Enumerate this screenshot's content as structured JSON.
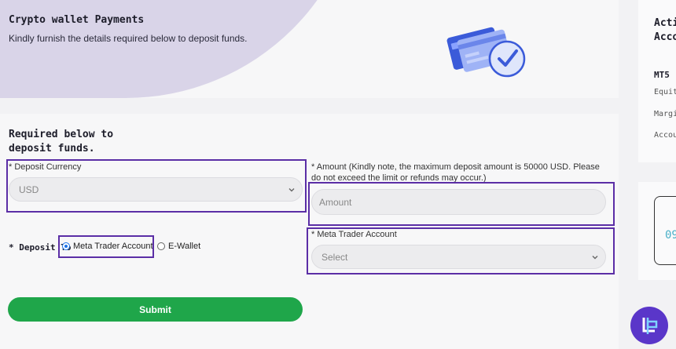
{
  "header": {
    "title": "Crypto wallet Payments",
    "subtitle": "Kindly furnish the details required below to deposit funds."
  },
  "form": {
    "heading": "Required below to deposit funds.",
    "deposit_currency": {
      "label": "* Deposit Currency",
      "value": "USD"
    },
    "amount": {
      "label": "* Amount (Kindly note, the maximum deposit amount is 50000 USD. Please do not exceed the limit or refunds may occur.)",
      "placeholder": "Amount"
    },
    "deposit_to": {
      "label": "* Deposit To",
      "options": [
        {
          "label": "Meta Trader Account",
          "checked": true
        },
        {
          "label": "E-Wallet",
          "checked": false
        }
      ]
    },
    "meta_trader_account": {
      "label": "* Meta Trader Account",
      "value": "Select"
    },
    "submit_label": "Submit"
  },
  "right_panel": {
    "title_line1": "Acti",
    "title_line2": "Acco",
    "mt5_label": "MT5 .",
    "rows": [
      "Equit",
      "Margi",
      "Accou"
    ],
    "account_number_partial": "09"
  },
  "colors": {
    "accent_purple": "#5b2ea6",
    "submit_green": "#1fa64a",
    "header_blob": "#d9d4e8",
    "logo_bg": "#5a36c9"
  },
  "icons": {
    "illustration": "credit-card-check-icon",
    "logo": "brand-logo-icon"
  }
}
